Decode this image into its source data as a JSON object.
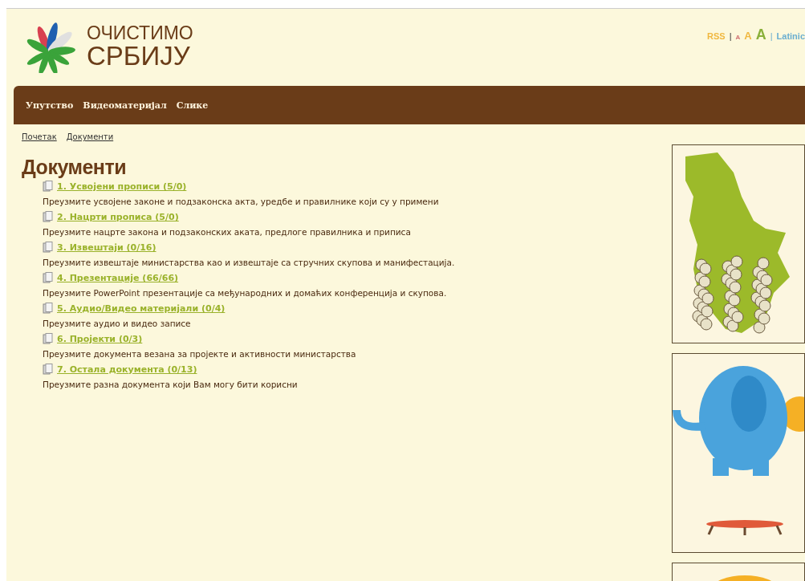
{
  "logo": {
    "line_1": "ОЧИСТИМО",
    "line_2": "СРБИЈУ"
  },
  "top_links": {
    "rss": "RSS",
    "separator_1": "|",
    "font_sizes": [
      "A",
      "A",
      "A"
    ],
    "separator_2": "|",
    "script": "Latinic"
  },
  "nav": [
    "Упутство",
    "Видеоматеријал",
    "Слике"
  ],
  "breadcrumbs": [
    "Почетак",
    "Документи"
  ],
  "title": "Документи",
  "documents": [
    {
      "link": "1. Усвојени прописи (5/0)",
      "description": "Преузмите усвојене законе и подзаконска акта, уредбе и правилнике који су у примени"
    },
    {
      "link": "2. Нацрти прописа (5/0)",
      "description": "Преузмите нацрте закона и подзаконских аката, предлоге правилника и приписа"
    },
    {
      "link": "3. Извештаји (0/16)",
      "description": "Преузмите извештаје министарства као и извештаје са стручних скупова и манифестација."
    },
    {
      "link": "4. Презентације (66/66)",
      "description": "Преузмите PowerPoint презентације са међународних и домаћих конференција и скупова."
    },
    {
      "link": "5. Аудио/Видео материјали (0/4)",
      "description": "Преузмите аудио и видео записе"
    },
    {
      "link": "6. Пројекти (0/3)",
      "description": "Преузмите документа везана за пројекте и активности министарства"
    },
    {
      "link": "7. Остала документа (0/13)",
      "description": "Преузмите разна документа који Вам могу бити корисни"
    }
  ],
  "banners": [
    {
      "kind": "map"
    },
    {
      "kind": "elephant"
    },
    {
      "kind": "sun"
    }
  ]
}
